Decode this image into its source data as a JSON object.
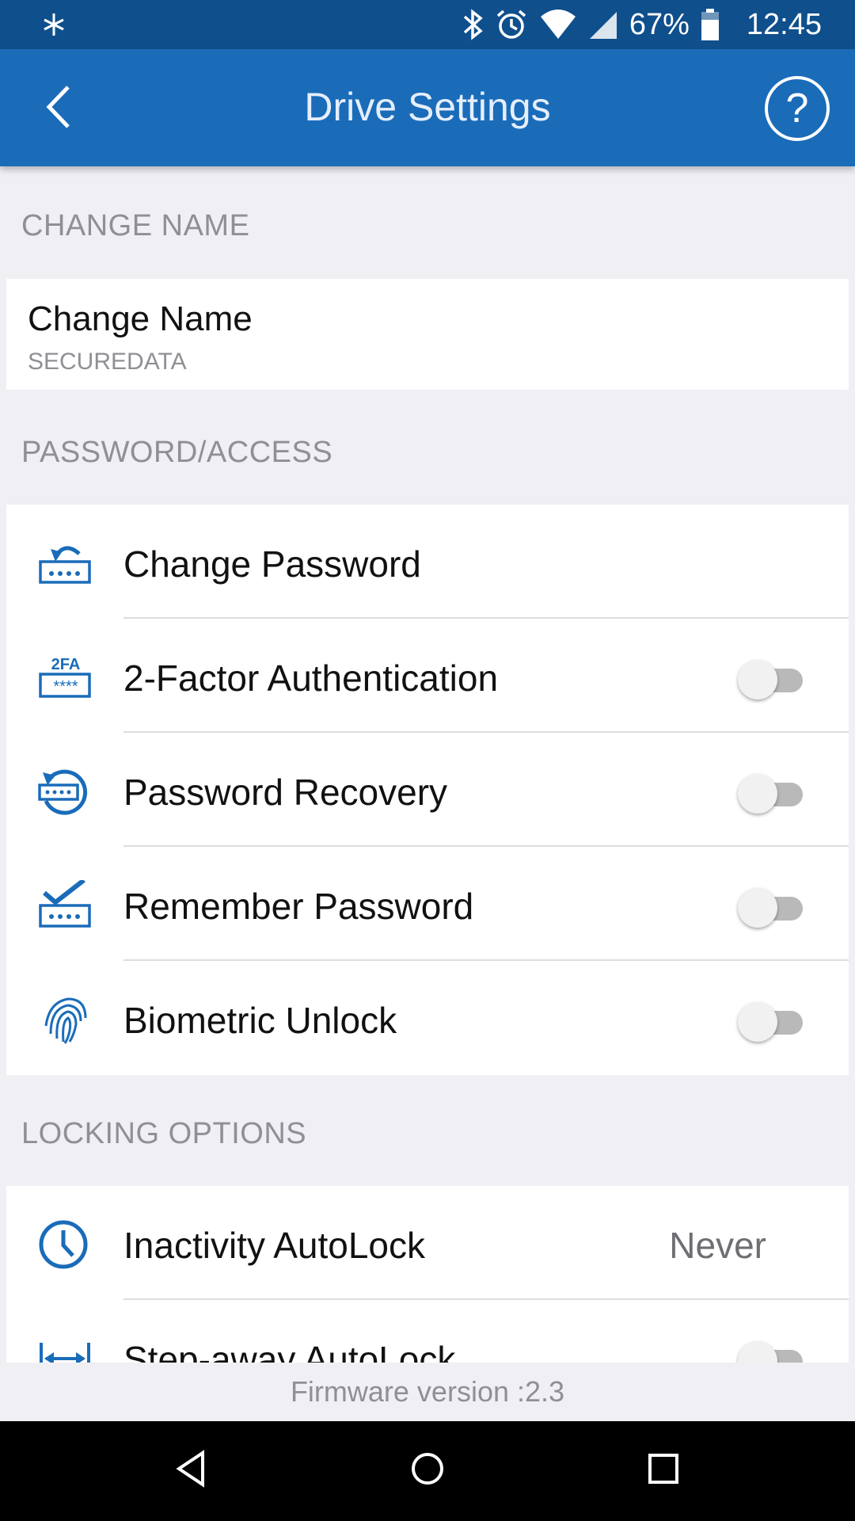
{
  "status_bar": {
    "battery_percent": "67%",
    "time": "12:45",
    "icons": [
      "notification-icon",
      "bluetooth-icon",
      "alarm-icon",
      "wifi-icon",
      "cell-signal-icon",
      "battery-icon"
    ]
  },
  "app_bar": {
    "title": "Drive Settings",
    "help_label": "?"
  },
  "sections": {
    "change_name": {
      "header": "CHANGE NAME",
      "item_title": "Change Name",
      "item_subtitle": "SECUREDATA"
    },
    "password_access": {
      "header": "PASSWORD/ACCESS",
      "items": [
        {
          "label": "Change Password",
          "icon": "change-password-icon"
        },
        {
          "label": "2-Factor Authentication",
          "icon": "2fa-icon",
          "toggle_on": false,
          "icon_text": "2FA"
        },
        {
          "label": "Password Recovery",
          "icon": "password-recovery-icon",
          "toggle_on": false
        },
        {
          "label": "Remember Password",
          "icon": "remember-password-icon",
          "toggle_on": false
        },
        {
          "label": "Biometric Unlock",
          "icon": "fingerprint-icon",
          "toggle_on": false
        }
      ]
    },
    "locking_options": {
      "header": "LOCKING OPTIONS",
      "items": [
        {
          "label": "Inactivity AutoLock",
          "icon": "clock-icon",
          "value": "Never"
        },
        {
          "label": "Step-away AutoLock",
          "icon": "step-away-icon",
          "toggle_on": false
        }
      ]
    }
  },
  "footer": {
    "firmware": "Firmware version :2.3"
  },
  "nav_bar": {
    "buttons": [
      "back-nav-icon",
      "home-nav-icon",
      "recents-nav-icon"
    ]
  },
  "colors": {
    "status_bar": "#0f4f8c",
    "app_bar": "#1a6cb9",
    "accent_icon": "#1a6cb9",
    "background": "#efeff4"
  }
}
